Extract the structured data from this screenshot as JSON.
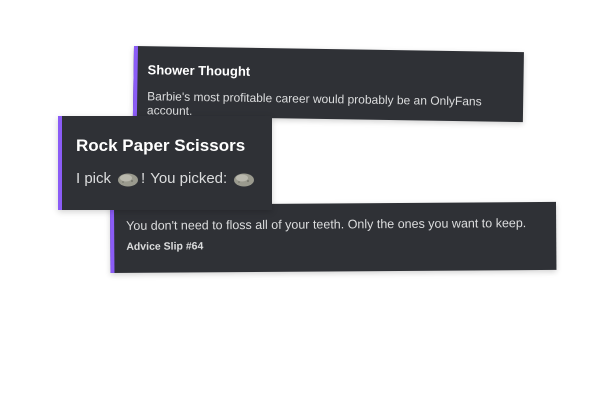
{
  "cards": {
    "shower": {
      "title": "Shower Thought",
      "body": "Barbie's most profitable career would probably be an OnlyFans account."
    },
    "rps": {
      "title": "Rock Paper Scissors",
      "pick_prefix": "I pick",
      "bang": "!",
      "you_picked": "You picked:",
      "user_choice_icon": "rock-emoji",
      "bot_choice_icon": "rock-emoji"
    },
    "advice": {
      "body": "You don't need to floss all of your teeth. Only the ones you want to keep.",
      "footer": "Advice Slip #64"
    }
  },
  "colors": {
    "embed_bg": "#2f3136",
    "accent": "#8b5cf6",
    "text": "#dcddde",
    "title": "#ffffff"
  }
}
